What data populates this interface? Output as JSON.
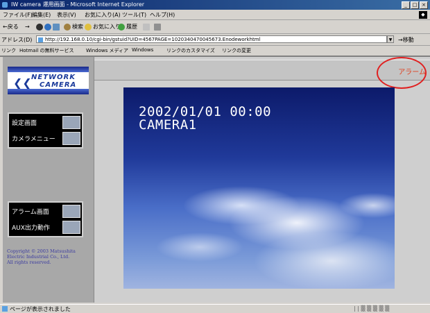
{
  "window": {
    "title": "IW camera 運用画面 - Microsoft Internet Explorer",
    "buttons": [
      "_",
      "□",
      "×"
    ]
  },
  "menubar": {
    "items": [
      "ファイル(F)",
      "編集(E)",
      "表示(V)",
      "お気に入り(A)",
      "ツール(T)",
      "ヘルプ(H)"
    ]
  },
  "toolbar": {
    "back": "←戻る",
    "forward": "→",
    "search": "検索",
    "favorites": "お気に入り",
    "history": "履歴"
  },
  "addressbar": {
    "label": "アドレス(D)",
    "url": "http://192.168.0.10/cgi-bin/gstuid?UID=4567PAGE=1020340470045673.Enodeworkhtml",
    "go_label": "移動"
  },
  "linksbar": {
    "label": "リンク",
    "items": [
      "Hotmail の無料サービス",
      "Windows メディア",
      "Windows",
      "リンクのカスタマイズ",
      "リンクの変更"
    ]
  },
  "page": {
    "logo_text": [
      "NETWORK",
      "CAMERA"
    ],
    "menu_group1": [
      "設定画面",
      "カメラメニュー"
    ],
    "menu_group2": [
      "アラーム画面",
      "AUX出力動作"
    ],
    "copyright": [
      "Copyright © 2003 Matsushita",
      "Electric Industrial Co., Ltd.",
      "All rights reserved."
    ],
    "alarm_label": "アラーム",
    "camera": {
      "datetime": "2002/01/01 00:00",
      "name": "CAMERA1"
    }
  },
  "statusbar": {
    "text": "ページが表示されました"
  },
  "colors": {
    "alarm": "#e04020",
    "highlight_circle": "#e02020",
    "titlebar": "#0a246a"
  }
}
